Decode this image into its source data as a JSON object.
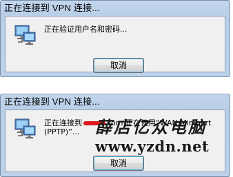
{
  "dialog1": {
    "title": "正在连接到 VPN 连接...",
    "message": "正在验证用户名和密码...",
    "cancel_label": "取消"
  },
  "dialog2": {
    "title": "正在连接到 VPN 连接...",
    "message_part1": "正在连接到",
    "message_part2": "com 正在使用“WAN Miniport",
    "message_part3": "(PPTP)”...",
    "cancel_label": "取消"
  },
  "watermark": {
    "line1": "薛店亿众电脑",
    "line2": "www.yzdn.net"
  },
  "colors": {
    "frame": "#b9cfe8",
    "panel": "#f0f0f0",
    "redaction": "#e0141c",
    "button_focus": "#4fb2e6"
  }
}
